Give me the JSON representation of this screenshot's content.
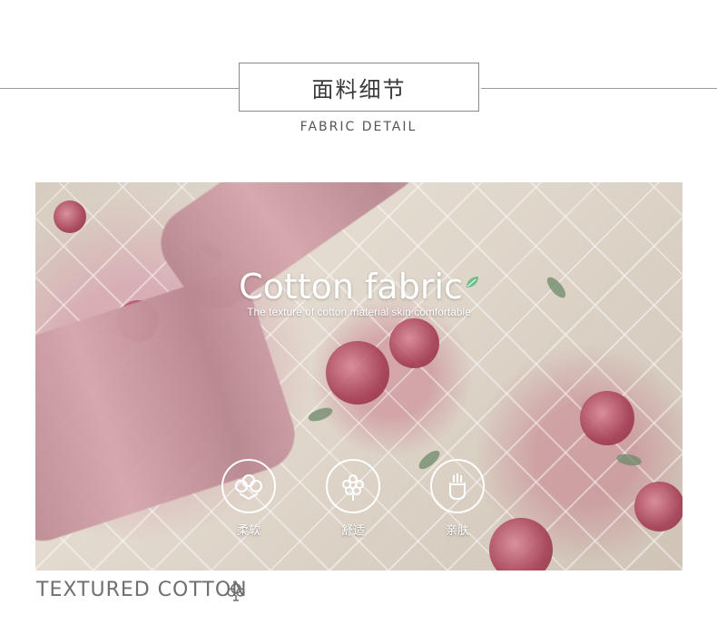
{
  "header": {
    "title": "面料细节",
    "subtitle": "FABRIC DETAIL"
  },
  "hero": {
    "title": "Cotton fabric",
    "subtitle": "The texture of cotton material skin comfortable",
    "features": [
      {
        "label": "柔软",
        "icon": "cotton-icon"
      },
      {
        "label": "舒适",
        "icon": "flower-icon"
      },
      {
        "label": "亲肤",
        "icon": "hand-icon"
      }
    ]
  },
  "footer": {
    "label": "TEXTURED COTTON",
    "icon": "cotton-boll-icon"
  }
}
